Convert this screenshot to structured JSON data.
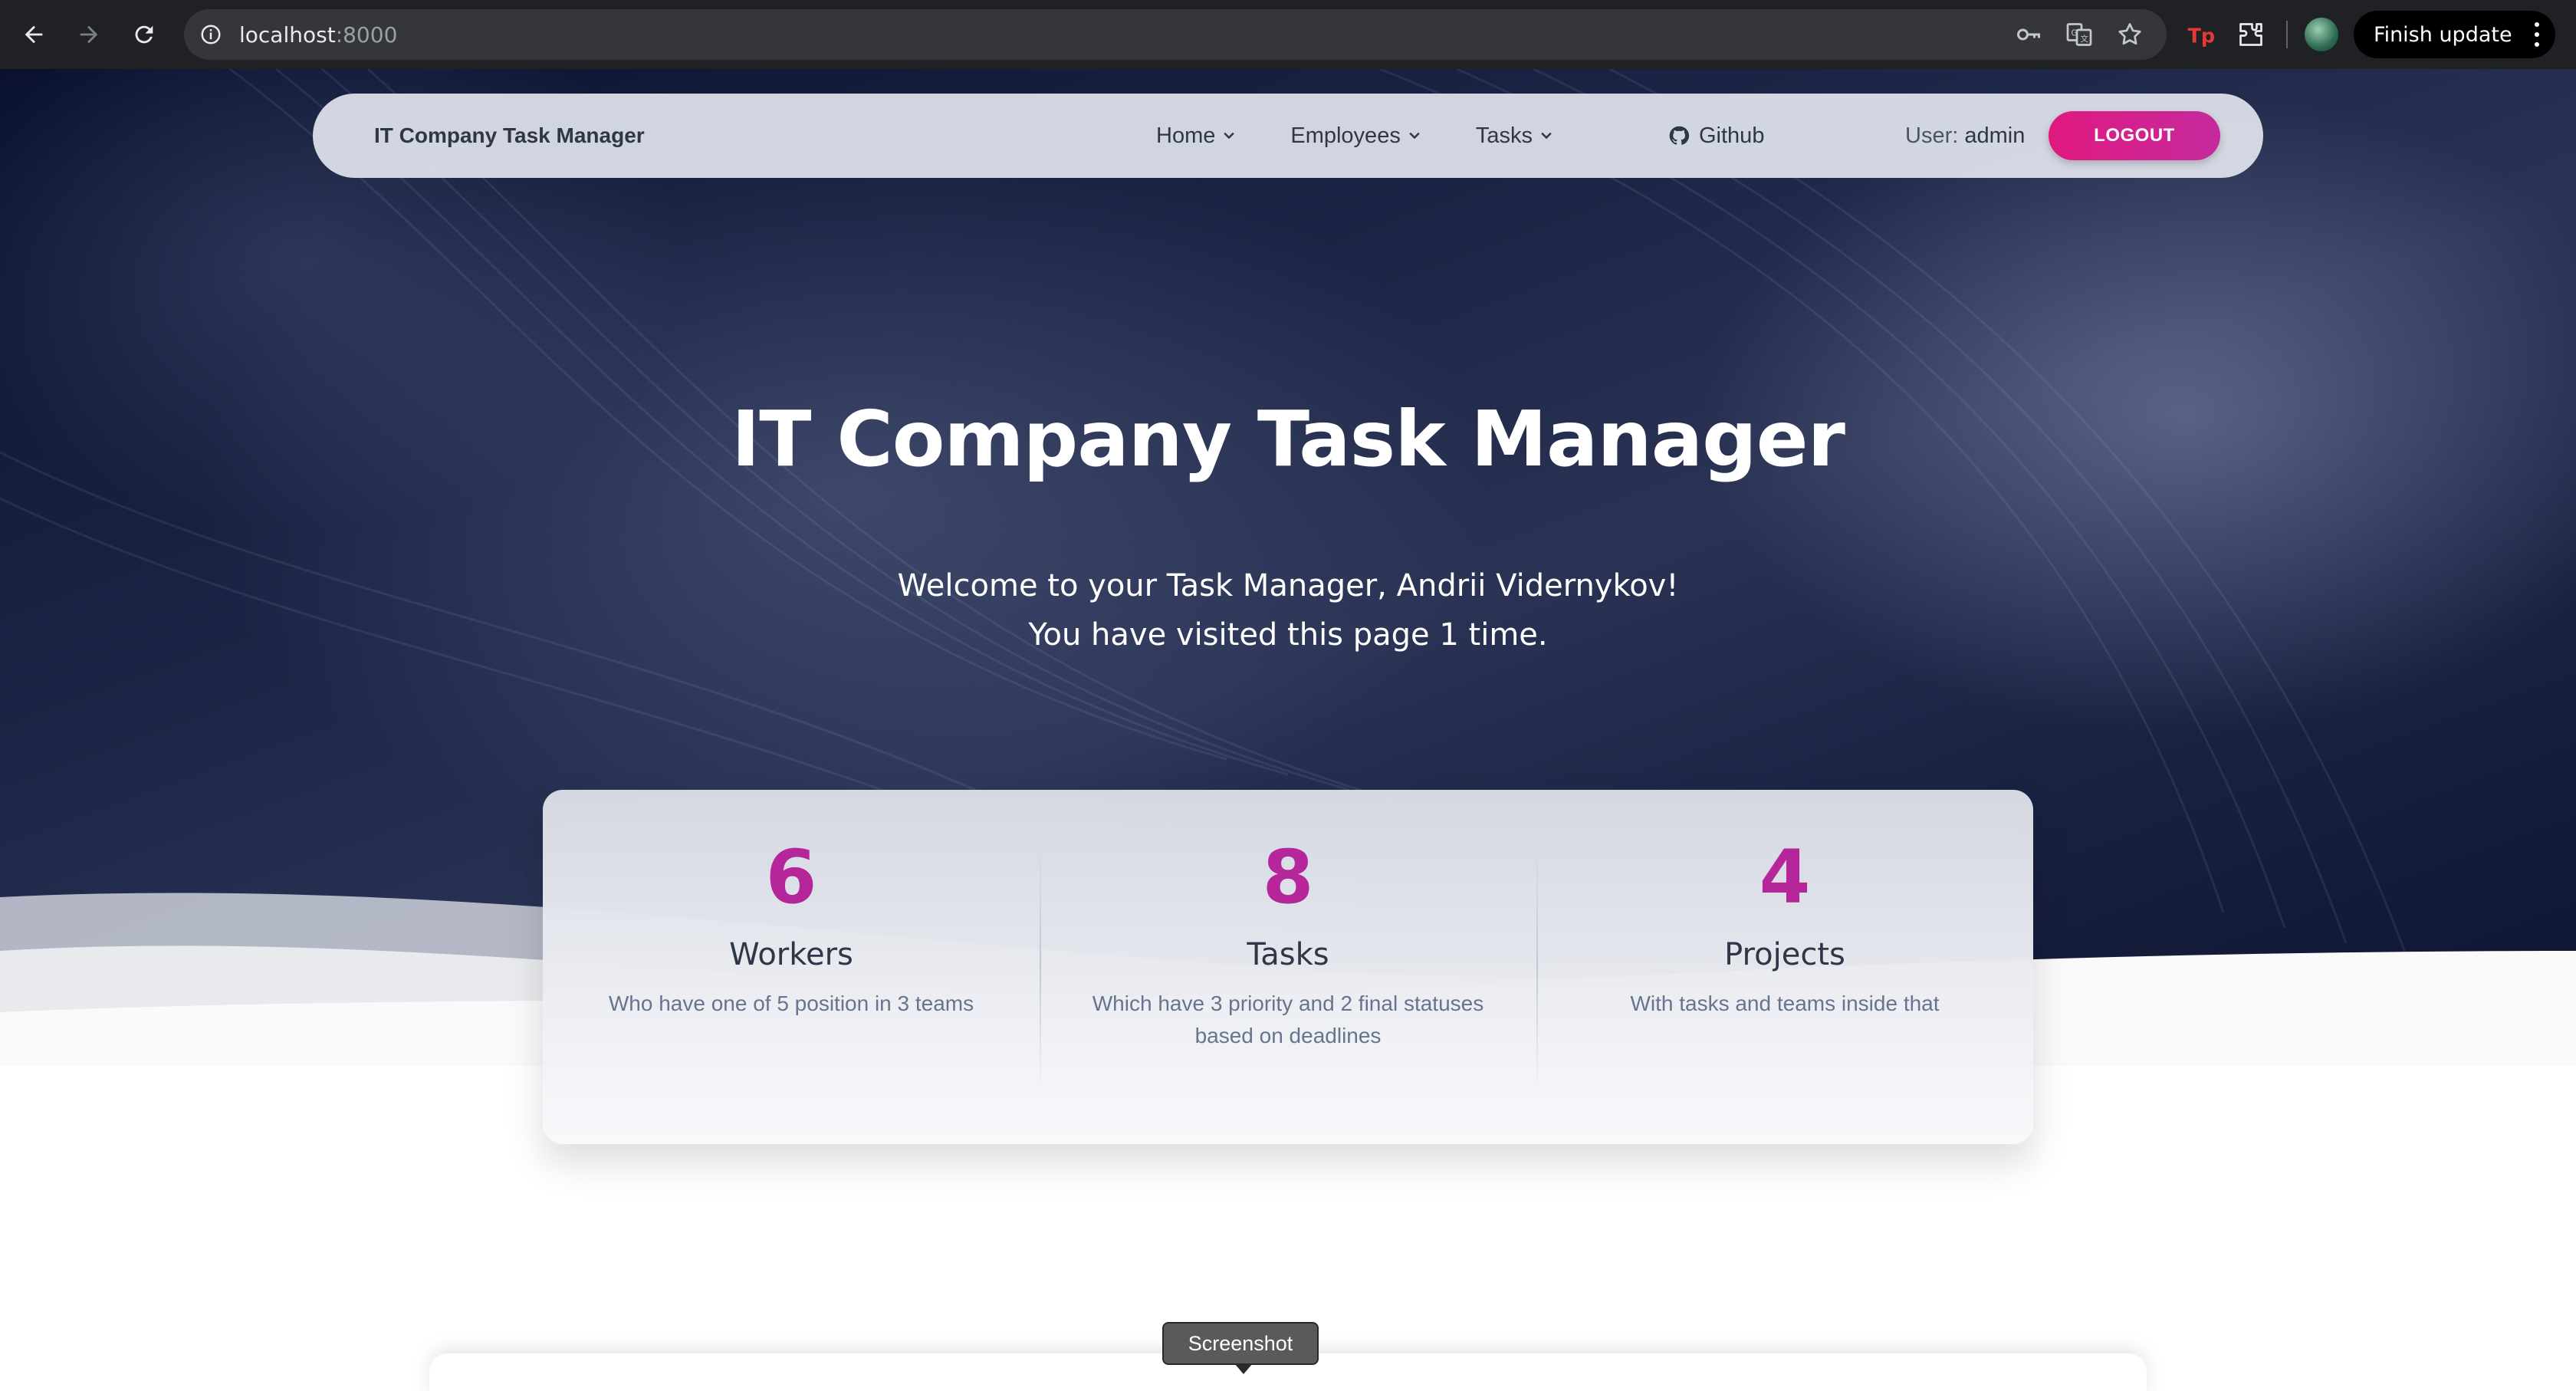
{
  "browser": {
    "url_host": "localhost",
    "url_port": ":8000",
    "finish_update_label": "Finish update"
  },
  "navbar": {
    "brand": "IT Company Task Manager",
    "menu": [
      {
        "label": "Home"
      },
      {
        "label": "Employees"
      },
      {
        "label": "Tasks"
      }
    ],
    "github_label": "Github",
    "user_prefix": "User:",
    "user_name": "admin",
    "logout_label": "LOGOUT"
  },
  "hero": {
    "title": "IT Company Task Manager",
    "welcome_line1": "Welcome to your Task Manager, Andrii Vidernykov!",
    "welcome_line2": "You have visited this page 1 time."
  },
  "stats": [
    {
      "number": "6",
      "title": "Workers",
      "description": "Who have one of 5 position in 3 teams"
    },
    {
      "number": "8",
      "title": "Tasks",
      "description": "Which have 3 priority and 2 final statuses based on deadlines"
    },
    {
      "number": "4",
      "title": "Projects",
      "description": "With tasks and teams inside that"
    }
  ],
  "tooltip": "Screenshot",
  "colors": {
    "accent": "#b5269a",
    "logout_gradient_start": "#e0197f",
    "logout_gradient_end": "#c42a9e",
    "hero_dark": "#0b1230"
  }
}
